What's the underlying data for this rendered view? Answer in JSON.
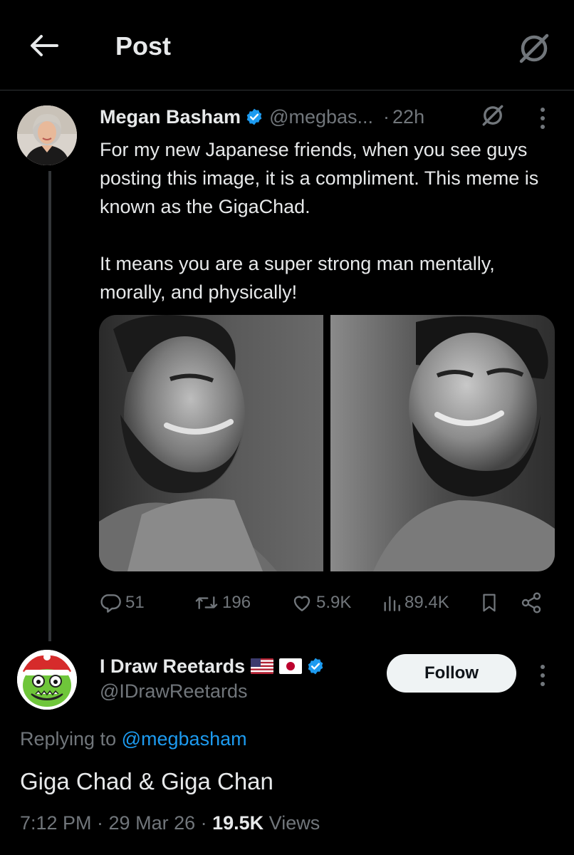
{
  "header": {
    "title": "Post",
    "back_icon": "arrow-left-icon",
    "grok_icon": "grok-icon"
  },
  "post": {
    "author_name": "Megan Basham",
    "author_handle": "@megbas...",
    "separator": "·",
    "time": "22h",
    "text_lines": [
      "For my new Japanese friends, when you see guys posting this image, it is a compliment. This meme is known as the GigaChad.",
      "It means you are a super strong man mentally, morally, and physically!"
    ],
    "actions": {
      "replies": "51",
      "reposts": "196",
      "likes": "5.9K",
      "views": "89.4K"
    }
  },
  "reply": {
    "author_name": "I Draw Reetards",
    "author_handle": "@IDrawReetards",
    "follow_label": "Follow",
    "replying_to_prefix": "Replying to",
    "replying_to_handle": "@megbasham",
    "text": "Giga Chad & Giga Chan",
    "timestamp": "7:12 PM · 29 Mar 26 · ",
    "views_count": "19.5K",
    "views_label": " Views"
  },
  "colors": {
    "background": "#000000",
    "text_primary": "#e7e9ea",
    "text_secondary": "#71767b",
    "accent_blue": "#1d9bf0",
    "verified_blue": "#1d9bf0",
    "follow_bg": "#eff3f4"
  }
}
